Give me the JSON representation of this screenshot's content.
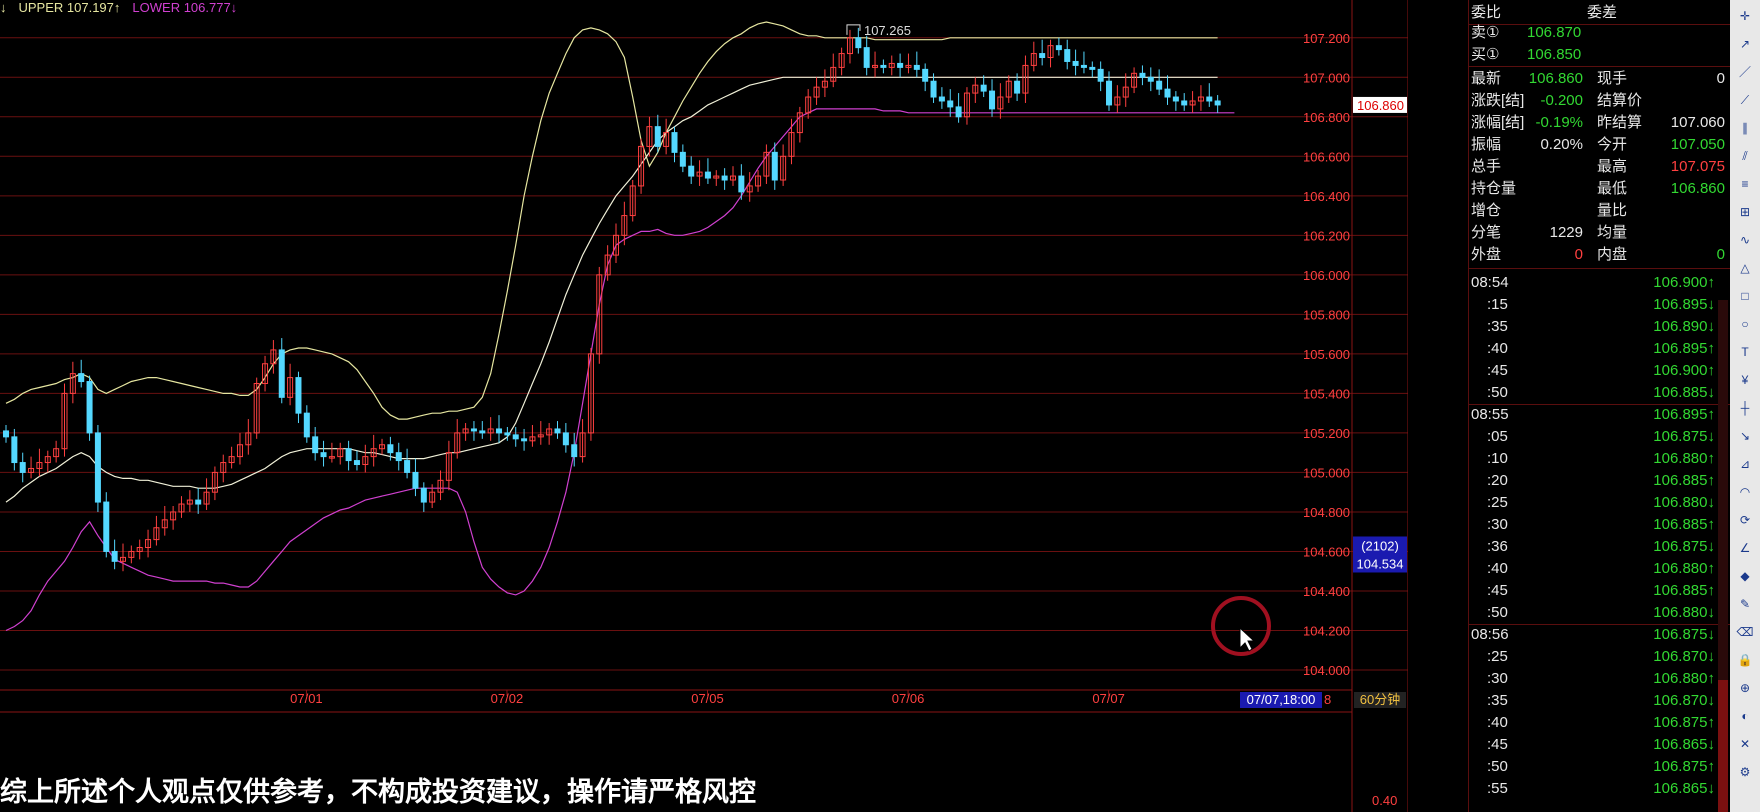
{
  "legend": {
    "prefix": "↓",
    "upper": "UPPER 107.197↑",
    "lower": "LOWER 106.777↓"
  },
  "chart_data": {
    "type": "candlestick",
    "ylim": [
      104.0,
      107.3
    ],
    "yticks": [
      "107.200",
      "107.000",
      "106.800",
      "106.600",
      "106.400",
      "106.200",
      "106.000",
      "105.800",
      "105.600",
      "105.400",
      "105.200",
      "105.000",
      "104.800",
      "104.600",
      "104.400",
      "104.200",
      "104.000"
    ],
    "ytick_values": [
      107.2,
      107.0,
      106.8,
      106.6,
      106.4,
      106.2,
      106.0,
      105.8,
      105.6,
      105.4,
      105.2,
      105.0,
      104.8,
      104.6,
      104.4,
      104.2,
      104.0
    ],
    "xlabels": [
      "07/01",
      "07/02",
      "07/05",
      "07/06",
      "07/07"
    ],
    "x_index_of_labels": [
      18,
      42,
      66,
      90,
      114
    ],
    "candle_count": 146,
    "last_price_tag": "106.860",
    "max_price_tag": "107.265",
    "cursor_tag_count": "(2102)",
    "cursor_tag_price": "104.534",
    "cursor_time_tag": "07/07,18:00",
    "cursor_time_suffix": "8",
    "period": "60分钟",
    "sub_value": "0.40",
    "closes": [
      105.18,
      105.05,
      105.0,
      105.02,
      105.05,
      105.08,
      105.12,
      105.4,
      105.5,
      105.46,
      105.2,
      104.85,
      104.6,
      104.55,
      104.57,
      104.6,
      104.62,
      104.66,
      104.72,
      104.76,
      104.8,
      104.84,
      104.86,
      104.84,
      104.9,
      105.0,
      105.05,
      105.08,
      105.14,
      105.2,
      105.45,
      105.55,
      105.62,
      105.38,
      105.48,
      105.3,
      105.18,
      105.1,
      105.08,
      105.08,
      105.12,
      105.06,
      105.04,
      105.08,
      105.12,
      105.14,
      105.1,
      105.06,
      105.0,
      104.92,
      104.85,
      104.9,
      104.96,
      105.1,
      105.2,
      105.22,
      105.21,
      105.2,
      105.22,
      105.2,
      105.19,
      105.17,
      105.16,
      105.18,
      105.19,
      105.22,
      105.2,
      105.14,
      105.08,
      105.2,
      105.6,
      106.0,
      106.1,
      106.2,
      106.3,
      106.45,
      106.65,
      106.75,
      106.65,
      106.72,
      106.62,
      106.55,
      106.5,
      106.52,
      106.49,
      106.5,
      106.48,
      106.5,
      106.42,
      106.45,
      106.5,
      106.62,
      106.48,
      106.6,
      106.72,
      106.82,
      106.9,
      106.95,
      106.98,
      107.05,
      107.12,
      107.2,
      107.15,
      107.05,
      107.06,
      107.05,
      107.07,
      107.05,
      107.06,
      107.04,
      106.98,
      106.9,
      106.88,
      106.85,
      106.8,
      106.92,
      106.96,
      106.93,
      106.84,
      106.9,
      106.98,
      106.92,
      107.06,
      107.12,
      107.1,
      107.16,
      107.14,
      107.08,
      107.06,
      107.05,
      107.04,
      106.98,
      106.86,
      106.9,
      106.95,
      107.02,
      107.0,
      106.98,
      106.94,
      106.9,
      106.88,
      106.86,
      106.88,
      106.9,
      106.88,
      106.86
    ],
    "upper_band": [
      105.35,
      105.37,
      105.4,
      105.42,
      105.43,
      105.44,
      105.45,
      105.47,
      105.48,
      105.5,
      105.48,
      105.42,
      105.4,
      105.42,
      105.44,
      105.46,
      105.47,
      105.48,
      105.48,
      105.47,
      105.46,
      105.45,
      105.44,
      105.43,
      105.42,
      105.41,
      105.4,
      105.4,
      105.39,
      105.39,
      105.42,
      105.48,
      105.55,
      105.6,
      105.62,
      105.63,
      105.63,
      105.62,
      105.61,
      105.6,
      105.58,
      105.56,
      105.52,
      105.46,
      105.4,
      105.33,
      105.29,
      105.27,
      105.27,
      105.28,
      105.29,
      105.3,
      105.3,
      105.31,
      105.31,
      105.32,
      105.33,
      105.38,
      105.5,
      105.7,
      105.92,
      106.15,
      106.4,
      106.6,
      106.78,
      106.92,
      107.02,
      107.12,
      107.2,
      107.24,
      107.25,
      107.24,
      107.22,
      107.18,
      107.1,
      106.9,
      106.68,
      106.55,
      106.62,
      106.72,
      106.8,
      106.88,
      106.95,
      107.02,
      107.08,
      107.13,
      107.17,
      107.2,
      107.22,
      107.25,
      107.27,
      107.28,
      107.27,
      107.26,
      107.24,
      107.22,
      107.21,
      107.21,
      107.2,
      107.2,
      107.2,
      107.2,
      107.2,
      107.2,
      107.19,
      107.19,
      107.19,
      107.19,
      107.19,
      107.19,
      107.19,
      107.19,
      107.19,
      107.2,
      107.2,
      107.2,
      107.2,
      107.2,
      107.2,
      107.2,
      107.2,
      107.2,
      107.2,
      107.2,
      107.2,
      107.2,
      107.2,
      107.2,
      107.2,
      107.2,
      107.2,
      107.2,
      107.2,
      107.2,
      107.2,
      107.2,
      107.2,
      107.2,
      107.2,
      107.2,
      107.2,
      107.2,
      107.2,
      107.2,
      107.2,
      107.2
    ],
    "middle_band": [
      104.85,
      104.88,
      104.92,
      104.95,
      104.98,
      105.0,
      105.02,
      105.05,
      105.08,
      105.1,
      105.08,
      105.03,
      105.0,
      104.98,
      104.97,
      104.97,
      104.96,
      104.96,
      104.95,
      104.94,
      104.93,
      104.93,
      104.93,
      104.92,
      104.92,
      104.92,
      104.93,
      104.94,
      104.96,
      104.98,
      105.0,
      105.02,
      105.05,
      105.08,
      105.1,
      105.11,
      105.12,
      105.12,
      105.12,
      105.12,
      105.12,
      105.12,
      105.11,
      105.1,
      105.1,
      105.09,
      105.08,
      105.07,
      105.07,
      105.07,
      105.07,
      105.08,
      105.09,
      105.1,
      105.1,
      105.11,
      105.12,
      105.13,
      105.14,
      105.15,
      105.18,
      105.25,
      105.35,
      105.45,
      105.55,
      105.66,
      105.78,
      105.9,
      106.0,
      106.1,
      106.18,
      106.26,
      106.33,
      106.4,
      106.45,
      106.5,
      106.56,
      106.62,
      106.68,
      106.72,
      106.75,
      106.78,
      106.8,
      106.83,
      106.86,
      106.88,
      106.9,
      106.92,
      106.94,
      106.96,
      106.97,
      106.98,
      106.99,
      107.0,
      107.0,
      107.0,
      107.0,
      107.0,
      107.0,
      107.0,
      107.0,
      107.0,
      107.0,
      107.0,
      107.0,
      107.0,
      107.0,
      107.0,
      107.0,
      107.0,
      107.0,
      107.0,
      107.0,
      107.0,
      107.0,
      107.0,
      107.0,
      107.0,
      107.0,
      107.0,
      107.0,
      107.0,
      107.0,
      107.0,
      107.0,
      107.0,
      107.0,
      107.0,
      107.0,
      107.0,
      107.0,
      107.0,
      107.0,
      107.0,
      107.0,
      107.0,
      107.0,
      107.0,
      107.0,
      107.0,
      107.0,
      107.0,
      107.0,
      107.0,
      107.0,
      107.0
    ],
    "lower_band": [
      104.2,
      104.22,
      104.25,
      104.3,
      104.38,
      104.45,
      104.5,
      104.55,
      104.62,
      104.7,
      104.75,
      104.68,
      104.62,
      104.56,
      104.54,
      104.52,
      104.5,
      104.48,
      104.47,
      104.46,
      104.45,
      104.45,
      104.45,
      104.45,
      104.45,
      104.44,
      104.44,
      104.43,
      104.42,
      104.42,
      104.45,
      104.5,
      104.55,
      104.6,
      104.65,
      104.68,
      104.71,
      104.74,
      104.77,
      104.79,
      104.81,
      104.82,
      104.84,
      104.86,
      104.87,
      104.88,
      104.89,
      104.9,
      104.91,
      104.92,
      104.92,
      104.92,
      104.92,
      104.92,
      104.9,
      104.8,
      104.65,
      104.52,
      104.46,
      104.42,
      104.39,
      104.38,
      104.4,
      104.45,
      104.52,
      104.62,
      104.75,
      104.9,
      105.1,
      105.35,
      105.6,
      105.85,
      106.05,
      106.15,
      106.18,
      106.2,
      106.22,
      106.22,
      106.23,
      106.21,
      106.2,
      106.2,
      106.21,
      106.22,
      106.24,
      106.27,
      106.3,
      106.34,
      106.4,
      106.47,
      106.54,
      106.6,
      106.65,
      106.7,
      106.75,
      106.8,
      106.82,
      106.84,
      106.84,
      106.84,
      106.84,
      106.84,
      106.84,
      106.84,
      106.84,
      106.83,
      106.83,
      106.83,
      106.82,
      106.82,
      106.82,
      106.82,
      106.82,
      106.82,
      106.82,
      106.82,
      106.82,
      106.82,
      106.82,
      106.82,
      106.82,
      106.82,
      106.82,
      106.82,
      106.82,
      106.82,
      106.82,
      106.82,
      106.82,
      106.82,
      106.82,
      106.82,
      106.82,
      106.82,
      106.82,
      106.82,
      106.82,
      106.82,
      106.82,
      106.82,
      106.82,
      106.82,
      106.82,
      106.82,
      106.82,
      106.82,
      106.82,
      106.82
    ]
  },
  "quote": {
    "wtb_label": "委比",
    "wtc_label": "委差",
    "sell_label": "卖①",
    "sell_value": "106.870",
    "buy_label": "买①",
    "buy_value": "106.850",
    "rows": [
      {
        "l1": "最新",
        "v1": "106.860",
        "l2": "现手",
        "v2": "0",
        "c1": "#32d832",
        "c2": "#e8e8e8"
      },
      {
        "l1": "涨跌[结]",
        "v1": "-0.200",
        "l2": "结算价",
        "v2": "",
        "c1": "#32d832",
        "c2": "#e8e8e8"
      },
      {
        "l1": "涨幅[结]",
        "v1": "-0.19%",
        "l2": "昨结算",
        "v2": "107.060",
        "c1": "#32d832",
        "c2": "#e8e8e8"
      },
      {
        "l1": "振幅",
        "v1": "0.20%",
        "l2": "今开",
        "v2": "107.050",
        "c1": "#e8e8e8",
        "c2": "#32d832"
      },
      {
        "l1": "总手",
        "v1": "",
        "l2": "最高",
        "v2": "107.075",
        "c1": "#e8e8e8",
        "c2": "#ff4040"
      },
      {
        "l1": "持仓量",
        "v1": "",
        "l2": "最低",
        "v2": "106.860",
        "c1": "#e8e8e8",
        "c2": "#32d832"
      },
      {
        "l1": "增仓",
        "v1": "",
        "l2": "量比",
        "v2": "",
        "c1": "#e8e8e8",
        "c2": "#e8e8e8"
      },
      {
        "l1": "分笔",
        "v1": "1229",
        "l2": "均量",
        "v2": "",
        "c1": "#e8e8e8",
        "c2": "#e8e8e8"
      },
      {
        "l1": "外盘",
        "v1": "0",
        "l2": "内盘",
        "v2": "0",
        "c1": "#ff4040",
        "c2": "#32d832"
      }
    ]
  },
  "ticks": [
    {
      "t": "08:54",
      "p": "106.900↑",
      "c": "#32d832",
      "head": true
    },
    {
      "t": ":15",
      "p": "106.895↓",
      "c": "#32d832"
    },
    {
      "t": ":35",
      "p": "106.890↓",
      "c": "#32d832"
    },
    {
      "t": ":40",
      "p": "106.895↑",
      "c": "#32d832"
    },
    {
      "t": ":45",
      "p": "106.900↑",
      "c": "#32d832"
    },
    {
      "t": ":50",
      "p": "106.885↓",
      "c": "#32d832"
    },
    {
      "t": "08:55",
      "p": "106.895↑",
      "c": "#32d832",
      "head": true
    },
    {
      "t": ":05",
      "p": "106.875↓",
      "c": "#32d832"
    },
    {
      "t": ":10",
      "p": "106.880↑",
      "c": "#32d832"
    },
    {
      "t": ":20",
      "p": "106.885↑",
      "c": "#32d832"
    },
    {
      "t": ":25",
      "p": "106.880↓",
      "c": "#32d832"
    },
    {
      "t": ":30",
      "p": "106.885↑",
      "c": "#32d832"
    },
    {
      "t": ":36",
      "p": "106.875↓",
      "c": "#32d832"
    },
    {
      "t": ":40",
      "p": "106.880↑",
      "c": "#32d832"
    },
    {
      "t": ":45",
      "p": "106.885↑",
      "c": "#32d832"
    },
    {
      "t": ":50",
      "p": "106.880↓",
      "c": "#32d832"
    },
    {
      "t": "08:56",
      "p": "106.875↓",
      "c": "#32d832",
      "head": true
    },
    {
      "t": ":25",
      "p": "106.870↓",
      "c": "#32d832"
    },
    {
      "t": ":30",
      "p": "106.880↑",
      "c": "#32d832"
    },
    {
      "t": ":35",
      "p": "106.870↓",
      "c": "#32d832"
    },
    {
      "t": ":40",
      "p": "106.875↑",
      "c": "#32d832"
    },
    {
      "t": ":45",
      "p": "106.865↓",
      "c": "#32d832"
    },
    {
      "t": ":50",
      "p": "106.875↑",
      "c": "#32d832"
    },
    {
      "t": ":55",
      "p": "106.865↓",
      "c": "#32d832"
    }
  ],
  "subtitle": "综上所述个人观点仅供参考，不构成投资建议，操作请严格风控",
  "toolbar_icons": [
    "cross-icon",
    "arrow-line-icon",
    "segment-icon",
    "ray-icon",
    "parallel-line-icon",
    "channel-icon",
    "fibonacci-icon",
    "gann-icon",
    "wave-icon",
    "triangle-icon",
    "rectangle-icon",
    "circle-icon",
    "text-icon",
    "price-tag-icon",
    "ruler-icon",
    "trend-icon",
    "fan-icon",
    "arc-icon",
    "cycle-icon",
    "angle-icon",
    "marker-icon",
    "pen-icon",
    "eraser-icon",
    "lock-icon",
    "magnet-icon",
    "hide-icon",
    "delete-icon",
    "settings-icon"
  ],
  "colors": {
    "up": "#ff4040",
    "down": "#54d8ff",
    "upper": "#e6e6a0",
    "middle": "#f0f0d8",
    "lower": "#d040d0",
    "grid": "#6a1010",
    "axis_text": "#ff4040"
  }
}
